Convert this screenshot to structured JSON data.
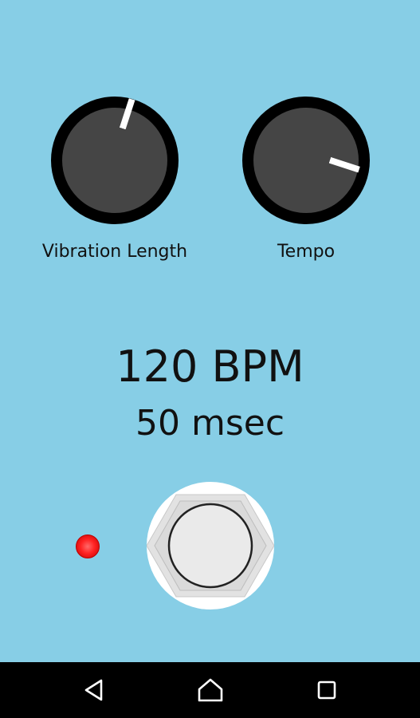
{
  "knobs": {
    "vibration_length": {
      "label": "Vibration Length",
      "rotation_deg": 18
    },
    "tempo": {
      "label": "Tempo",
      "rotation_deg": 108
    }
  },
  "display": {
    "bpm_text": "120 BPM",
    "msec_text": "50 msec"
  },
  "colors": {
    "background": "#87CEE6",
    "knob_body": "#454545",
    "knob_ring": "#000000",
    "led": "#ff2222",
    "navbar": "#000000"
  },
  "icons": {
    "led": "led-indicator",
    "footswitch": "footswitch-icon",
    "back": "back-icon",
    "home": "home-icon",
    "recents": "recents-icon"
  }
}
